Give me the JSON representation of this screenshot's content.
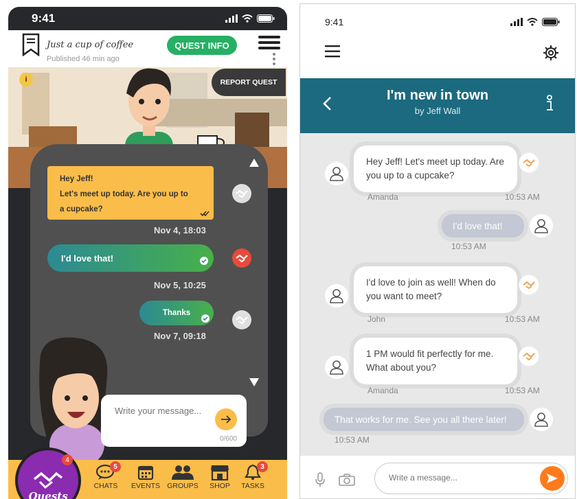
{
  "left_app": {
    "status": {
      "time": "9:41"
    },
    "header": {
      "title": "Just a cup of coffee",
      "published": "Published 46 min ago",
      "quest_info_label": "QUEST INFO",
      "report_quest_label": "REPORT QUEST",
      "info_badge": "i"
    },
    "messages": [
      {
        "lines": [
          "Hey Jeff!",
          "Let's meet up today. Are you up to",
          "a cupcake?"
        ],
        "time": "Nov 4, 18:03"
      },
      {
        "text": "I'd love that!",
        "time": "Nov 5, 10:25"
      },
      {
        "text": "Thanks",
        "time": "Nov 7, 09:18"
      }
    ],
    "composer": {
      "placeholder": "Write your message...",
      "counter": "0/600"
    },
    "tabbar": {
      "quests": {
        "label": "Quests",
        "badge": "4"
      },
      "tabs": [
        {
          "label": "CHATS",
          "icon": "chat-icon",
          "badge": "5"
        },
        {
          "label": "EVENTS",
          "icon": "calendar-icon",
          "badge": ""
        },
        {
          "label": "GROUPS",
          "icon": "group-icon",
          "badge": ""
        },
        {
          "label": "SHOP",
          "icon": "shop-icon",
          "badge": ""
        },
        {
          "label": "TASKS",
          "icon": "bell-icon",
          "badge": "3"
        }
      ]
    },
    "colors": {
      "accent": "#fbbd4a",
      "green": "#26b064",
      "panel": "#505050",
      "quests": "#8a2bb0"
    }
  },
  "right_app": {
    "status": {
      "time": "9:41"
    },
    "header": {
      "title": "I'm new in town",
      "subtitle": "by Jeff Wall"
    },
    "messages": [
      {
        "direction": "in",
        "text": "Hey Jeff! Let's meet up today. Are you up to a cupcake?",
        "author": "Amanda",
        "time": "10:53 AM"
      },
      {
        "direction": "out",
        "text": "I'd love that!",
        "time": "10:53 AM"
      },
      {
        "direction": "in",
        "text": "I'd love to join as well! When do you want to meet?",
        "author": "John",
        "time": "10:53 AM"
      },
      {
        "direction": "in",
        "text": "1 PM would fit perfectly for me. What about you?",
        "author": "Amanda",
        "time": "10:53 AM"
      },
      {
        "direction": "out",
        "text": "That works for me. See you all there later!",
        "time": "10:53 AM"
      }
    ],
    "composer": {
      "placeholder": "Write a message..."
    },
    "colors": {
      "header": "#1b6a7f",
      "send": "#ff7a1a",
      "outgoing": "#c3c8d4"
    }
  }
}
